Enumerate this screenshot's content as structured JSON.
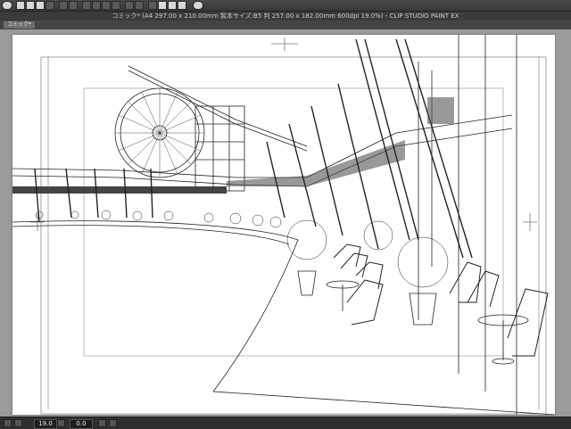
{
  "window": {
    "title": "コミック* (A4 297.00 x 210.00mm 製本サイズ:B5 判 257.00 x 182.00mm 600dpi 19.0%)  - CLIP STUDIO PAINT EX"
  },
  "tabs": [
    {
      "label": "コミック*"
    }
  ],
  "toolbar": {
    "icons": [
      "app-menu-icon",
      "new-icon",
      "open-icon",
      "save-icon",
      "page-icon",
      "undo-icon",
      "redo-icon",
      "transform-icon",
      "ruler-icon",
      "snap-icon",
      "grid-icon",
      "help-icon"
    ]
  },
  "status": {
    "zoom": "19.0",
    "angle": "0.0"
  }
}
